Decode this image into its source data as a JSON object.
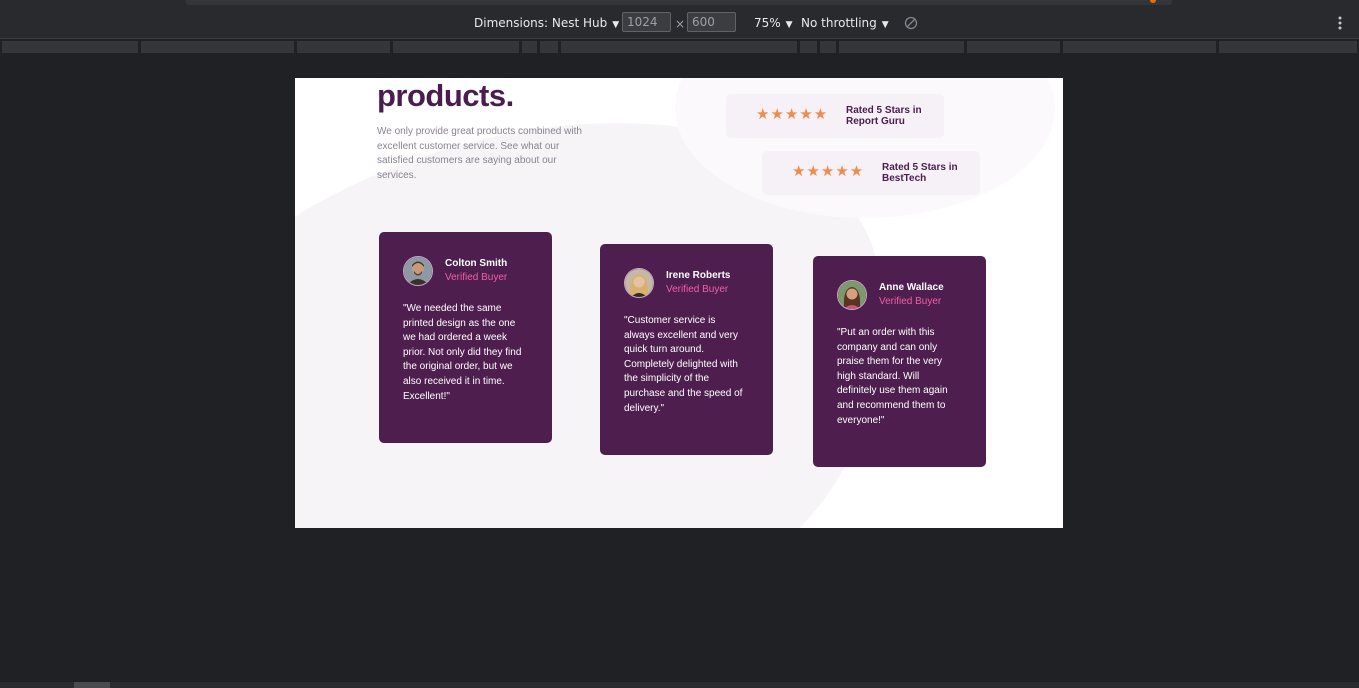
{
  "devtools": {
    "dimensions_label": "Dimensions: Nest Hub",
    "width_value": "1024",
    "height_value": "600",
    "times_symbol": "×",
    "zoom": "75%",
    "throttling": "No throttling",
    "caret": "▼"
  },
  "page": {
    "hero_title": "products.",
    "hero_description": "We only provide great products combined with excellent customer service. See what our satisfied customers are saying about our services.",
    "ratings": [
      {
        "stars": "★★★★★",
        "text": "Rated 5 Stars in Report Guru"
      },
      {
        "stars": "★★★★★",
        "text": "Rated 5 Stars in BestTech"
      }
    ],
    "testimonials": [
      {
        "name": "Colton Smith",
        "badge": "Verified Buyer",
        "quote": "\"We needed the same printed design as the one we had ordered a week prior. Not only did they find the original order, but we also received it in time. Excellent!\""
      },
      {
        "name": "Irene Roberts",
        "badge": "Verified Buyer",
        "quote": "\"Customer service is always excellent and very quick turn around. Completely delighted with the simplicity of the purchase and the speed of delivery.\""
      },
      {
        "name": "Anne Wallace",
        "badge": "Verified Buyer",
        "quote": "\"Put an order with this company and can only praise them for the very high standard. Will definitely use them again and recommend them to everyone!\""
      }
    ]
  },
  "colors": {
    "brand_purple": "#4b1d4f",
    "card_bg": "#4e1f4e",
    "accent_pink": "#f05fa6",
    "star_orange": "#ee8c4e",
    "rating_bg": "#f6f0f7"
  }
}
